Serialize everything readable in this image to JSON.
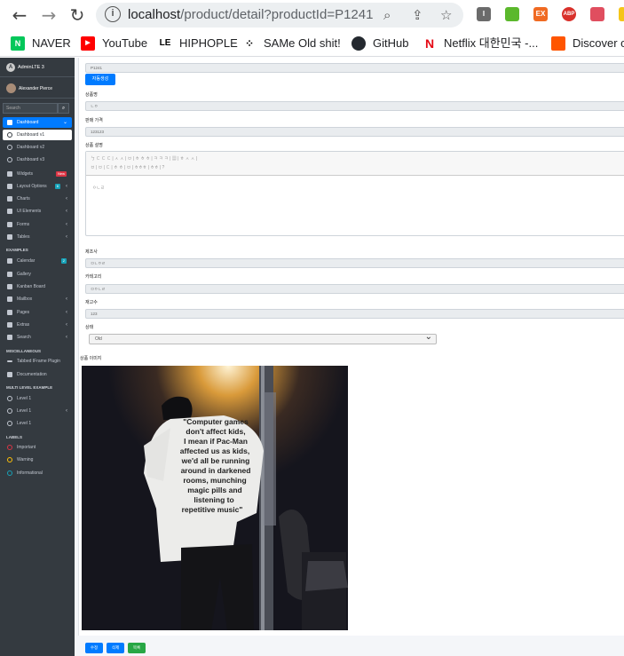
{
  "browser": {
    "url_host": "localhost",
    "url_path": "/product/detail?productId=P1241",
    "bookmarks": [
      "NAVER",
      "YouTube",
      "HIPHOPLE",
      "SAMe Old shit!",
      "GitHub",
      "Netflix 대한민국 -...",
      "Discover o"
    ],
    "bookmark_icon_letters": [
      "N",
      "▶",
      "LE",
      "⁘",
      "",
      "N",
      ""
    ],
    "extension_letters": [
      "I",
      "",
      "EX",
      "ABP",
      "",
      ""
    ]
  },
  "sidebar": {
    "brand": "AdminLTE 3",
    "user": "Alexander Pierce",
    "search_placeholder": "Search",
    "items": [
      {
        "label": "Dashboard",
        "active": true
      },
      {
        "label": "Dashboard v1",
        "sub": true,
        "sub_active": true
      },
      {
        "label": "Dashboard v2",
        "sub": true
      },
      {
        "label": "Dashboard v3",
        "sub": true
      },
      {
        "label": "Widgets",
        "badge": "New"
      },
      {
        "label": "Layout Options",
        "badge": "6"
      },
      {
        "label": "Charts"
      },
      {
        "label": "UI Elements"
      },
      {
        "label": "Forms"
      },
      {
        "label": "Tables"
      }
    ],
    "header_examples": "EXAMPLES",
    "examples": [
      {
        "label": "Calendar",
        "badge": "2"
      },
      {
        "label": "Gallery"
      },
      {
        "label": "Kanban Board"
      },
      {
        "label": "Mailbox"
      },
      {
        "label": "Pages"
      },
      {
        "label": "Extras"
      },
      {
        "label": "Search"
      }
    ],
    "header_misc": "MISCELLANEOUS",
    "misc": [
      {
        "label": "Tabbed IFrame Plugin"
      },
      {
        "label": "Documentation"
      }
    ],
    "header_multi": "MULTI LEVEL EXAMPLE",
    "multi": [
      {
        "label": "Level 1"
      },
      {
        "label": "Level 1"
      },
      {
        "label": "Level 1"
      }
    ],
    "header_labels": "LABELS",
    "labels": [
      {
        "label": "Important",
        "color": "#dc3545"
      },
      {
        "label": "Warning",
        "color": "#ffc107"
      },
      {
        "label": "Informational",
        "color": "#17a2b8"
      }
    ]
  },
  "form": {
    "product_id_value": "P1241",
    "generate_button": "자동생성",
    "name_label": "상품명",
    "name_value": "ㄴㅇ",
    "price_label": "판매 가격",
    "price_value": "123123",
    "desc_label": "상품 설명",
    "toolbar_row1": "ㄅ ㄷ ㄷ ㄷ | ㅅ ㅅ | ㅂ | ㅎ ㅎ ㅎ | ㅋ ㅋ ㅋ | ▦ | ㅎ ㅅ ㅅ |",
    "toolbar_row2": "ㅂ | ㅂ | ㄷ | ㅎ ㅎ | ㅂ | ㅎㅎㅎ | ㅎㅎ | ?",
    "desc_value": "ㅇㄴㄹ",
    "maker_label": "제조사",
    "maker_value": "ㅁㄴㅇㄹ",
    "category_label": "카테고리",
    "category_value": "ㅁㅇㄴㄹ",
    "stock_label": "재고수",
    "stock_value": "123",
    "state_label": "상태",
    "state_value": "Old",
    "image_label": "상품 이미지",
    "shirt_text": [
      "\"Computer games",
      "don't affect kids,",
      "I mean if Pac-Man",
      "affected us as kids,",
      "we'd all be running",
      "around in darkened",
      "rooms, munching",
      "magic pills and",
      "listening to",
      "repetitive music\""
    ]
  },
  "actions": {
    "edit": "수정",
    "delete": "삭제",
    "list": "목록",
    "edit_color": "#007bff",
    "delete_color": "#007bff",
    "list_color": "#28a745"
  }
}
